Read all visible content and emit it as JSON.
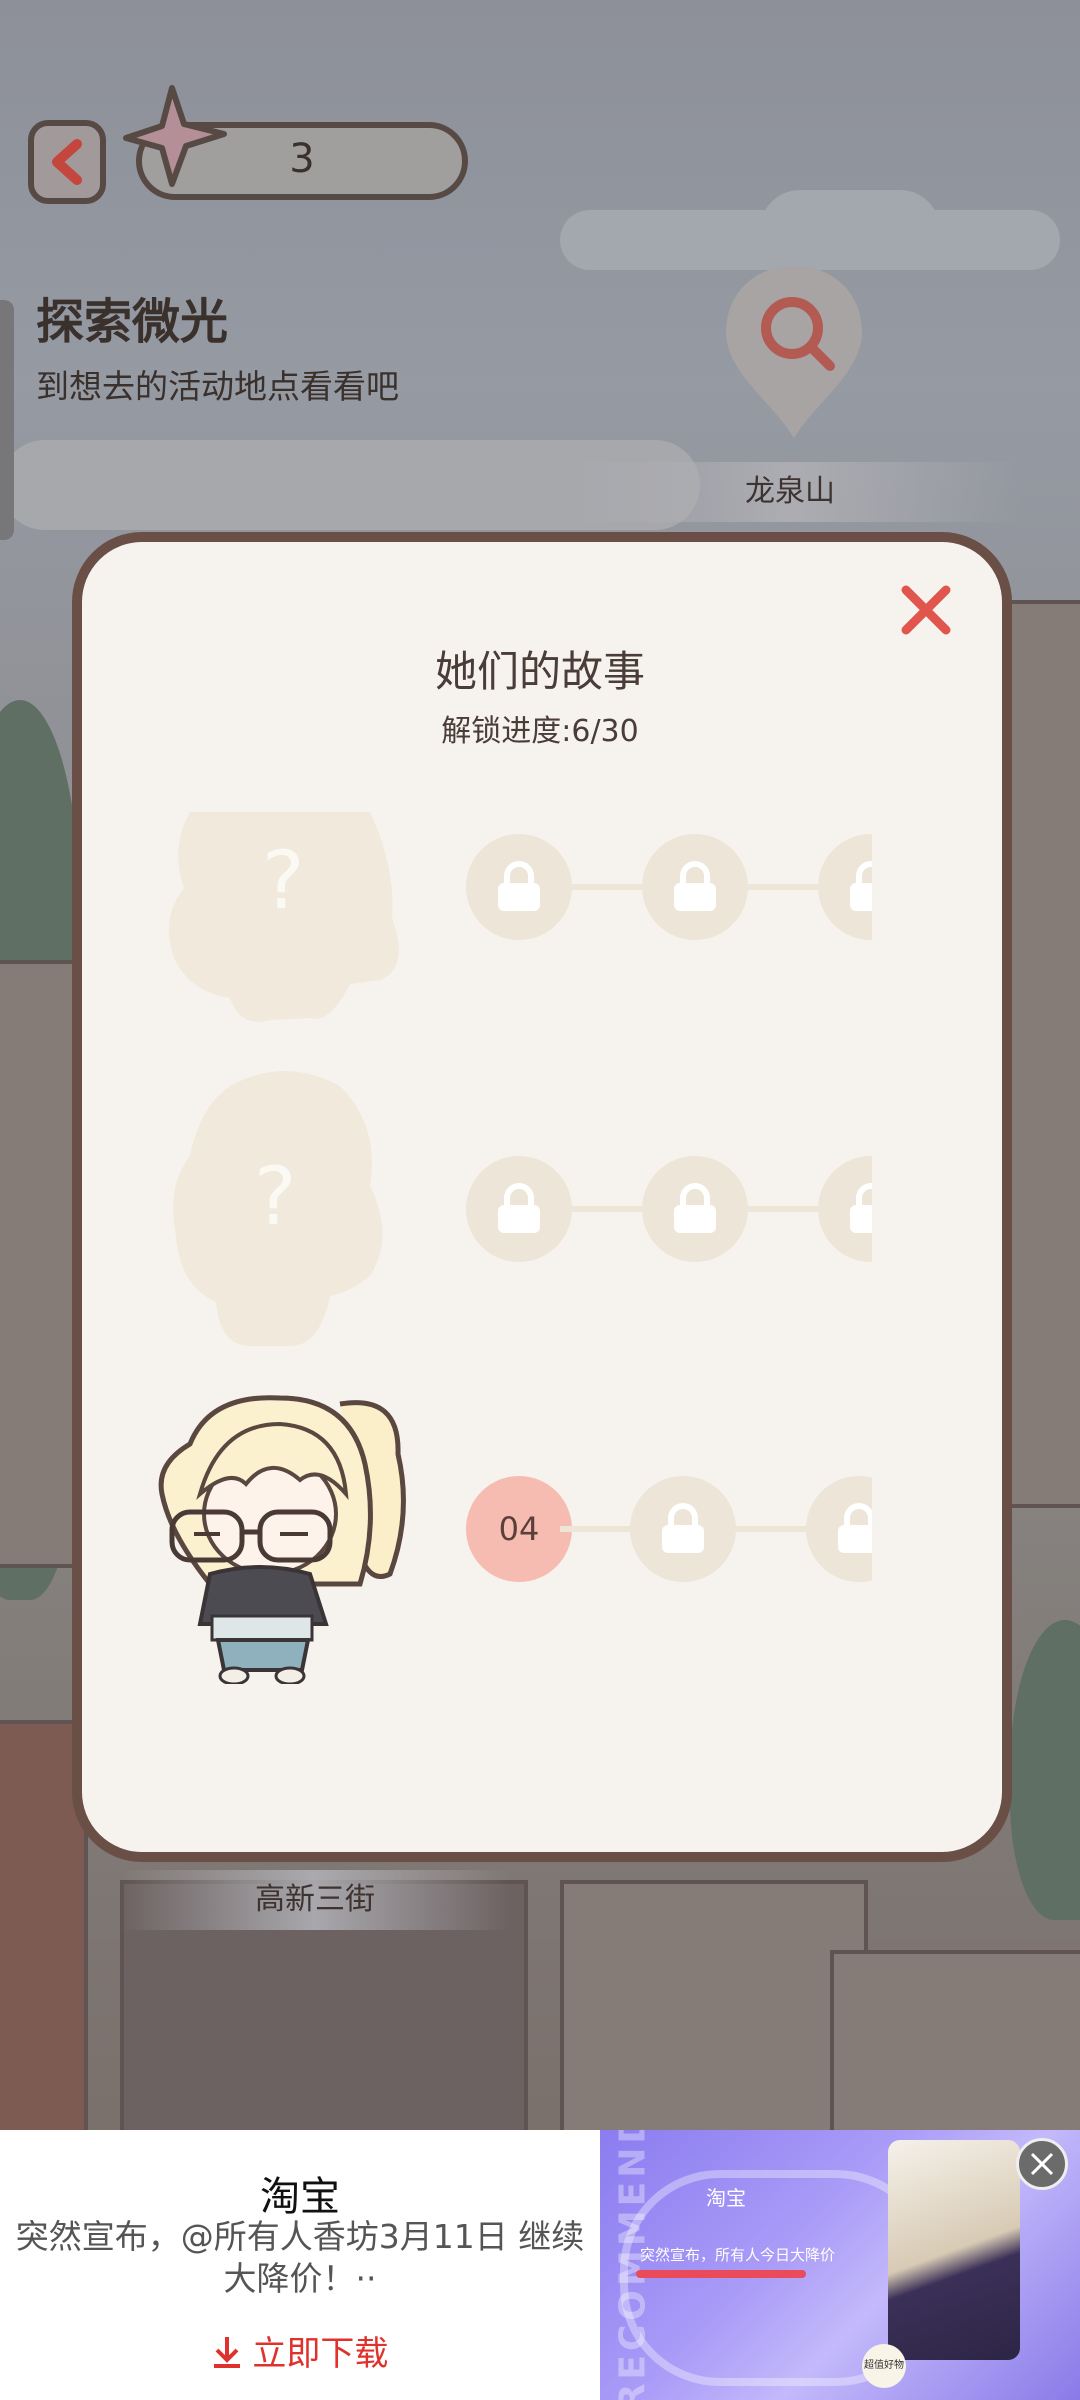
{
  "top_bar": {
    "star_count": "3"
  },
  "header": {
    "title": "探索微光",
    "subtitle": "到想去的活动地点看看吧"
  },
  "locations": {
    "top_right": "龙泉山",
    "bottom_left": "高新三街"
  },
  "modal": {
    "title": "她们的故事",
    "progress": "解锁进度:6/30",
    "rows": [
      {
        "character": "locked",
        "placeholder": "?",
        "nodes": [
          "locked",
          "locked",
          "locked"
        ]
      },
      {
        "character": "locked",
        "placeholder": "?",
        "nodes": [
          "locked",
          "locked",
          "locked"
        ]
      },
      {
        "character": "unlocked",
        "nodes": [
          "04",
          "locked",
          "locked"
        ]
      }
    ]
  },
  "ad": {
    "title": "淘宝",
    "description": "突然宣布，@所有人香坊3月11日 继续大降价！··",
    "cta": "立即下载",
    "image_title": "淘宝",
    "image_caption": "突然宣布，所有人今日大降价",
    "vertical_text": "RECOMMEND",
    "badge": "超值好物"
  },
  "colors": {
    "modal_bg": "#f6f3ee",
    "modal_border": "#6a4f46",
    "close_x": "#e0564c",
    "unlocked_node": "#f6bcb2",
    "locked_node": "#ece5d8",
    "cta": "#e0322c"
  }
}
